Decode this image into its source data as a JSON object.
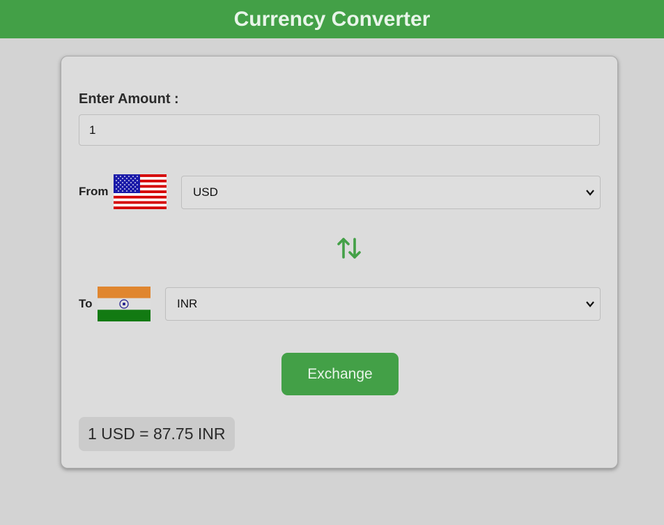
{
  "header": {
    "title": "Currency Converter"
  },
  "amount": {
    "label": "Enter Amount :",
    "value": "1"
  },
  "from": {
    "label": "From",
    "flag_icon": "us-flag-icon",
    "selected": "USD"
  },
  "to": {
    "label": "To",
    "flag_icon": "india-flag-icon",
    "selected": "INR"
  },
  "swap": {
    "icon": "swap-arrows-icon"
  },
  "exchange_button": {
    "label": "Exchange"
  },
  "result": {
    "text": "1 USD = 87.75 INR"
  },
  "colors": {
    "accent": "#43a047",
    "background": "#d3d3d3",
    "card": "#dcdcdc"
  }
}
